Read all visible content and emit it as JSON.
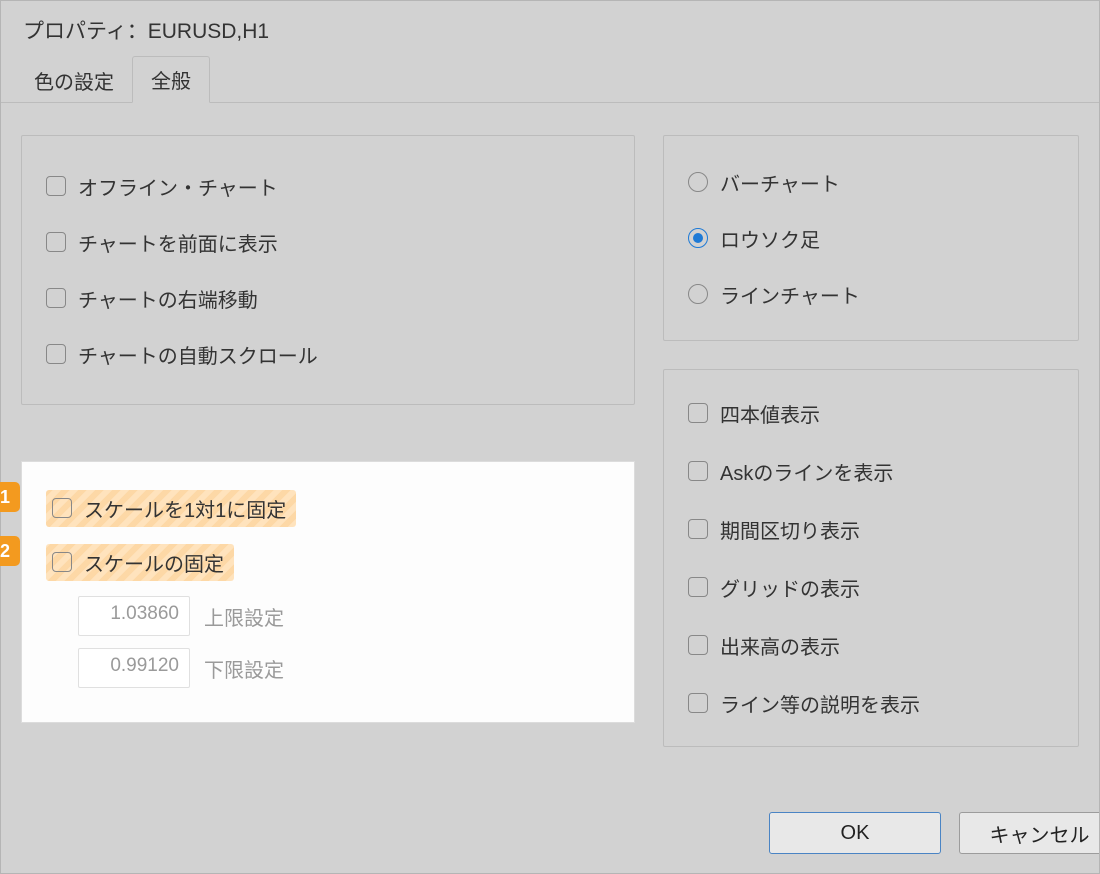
{
  "window": {
    "title": "プロパティ：EURUSD,H1"
  },
  "tabs": {
    "colors": "色の設定",
    "general": "全般"
  },
  "left": {
    "offline_chart": "オフライン・チャート",
    "chart_front": "チャートを前面に表示",
    "chart_right_shift": "チャートの右端移動",
    "chart_autoscroll": "チャートの自動スクロール"
  },
  "scale": {
    "marker1": "1",
    "marker2": "2",
    "fix_1to1": "スケールを1対1に固定",
    "fix_scale": "スケールの固定",
    "upper_value": "1.03860",
    "upper_label": "上限設定",
    "lower_value": "0.99120",
    "lower_label": "下限設定"
  },
  "chart_type": {
    "bar": "バーチャート",
    "candle": "ロウソク足",
    "line": "ラインチャート"
  },
  "display": {
    "ohlc": "四本値表示",
    "ask_line": "Askのラインを表示",
    "period_sep": "期間区切り表示",
    "grid": "グリッドの表示",
    "volume": "出来高の表示",
    "descriptions": "ライン等の説明を表示"
  },
  "buttons": {
    "ok": "OK",
    "cancel": "キャンセル"
  }
}
